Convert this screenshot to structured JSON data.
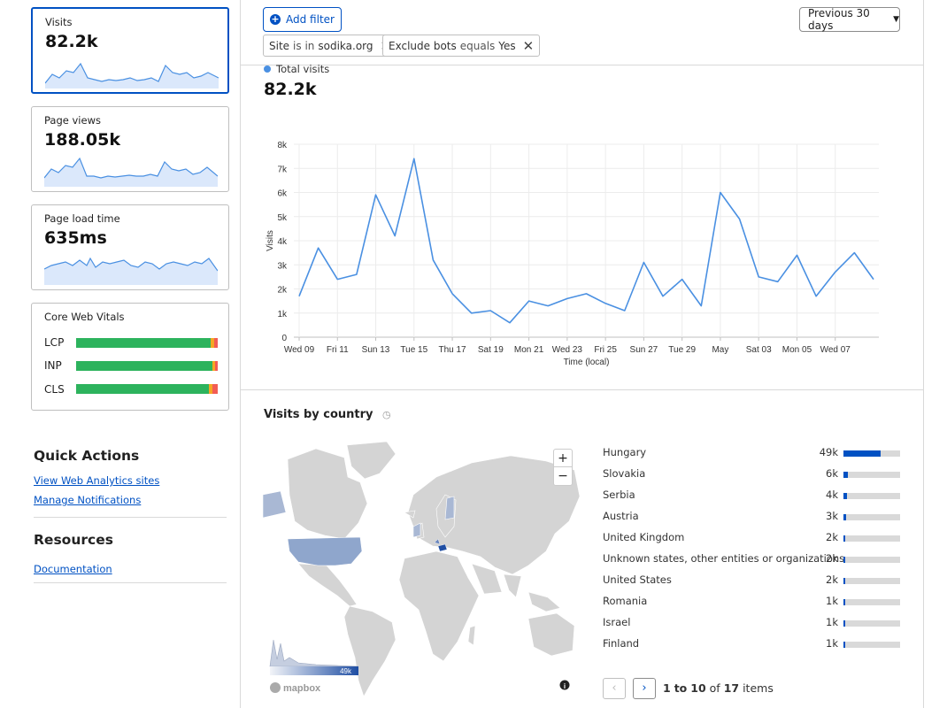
{
  "cards": {
    "visits": {
      "title": "Visits",
      "value": "82.2k"
    },
    "pageviews": {
      "title": "Page views",
      "value": "188.05k"
    },
    "loadtime": {
      "title": "Page load time",
      "value": "635ms"
    },
    "cwv": {
      "title": "Core Web Vitals",
      "metrics": [
        {
          "label": "LCP",
          "good": 0.95,
          "ni": 0.025,
          "poor": 0.025
        },
        {
          "label": "INP",
          "good": 0.96,
          "ni": 0.02,
          "poor": 0.02
        },
        {
          "label": "CLS",
          "good": 0.94,
          "ni": 0.02,
          "poor": 0.04
        }
      ]
    }
  },
  "quick_actions": {
    "title": "Quick Actions",
    "links": [
      "View Web Analytics sites",
      "Manage Notifications"
    ]
  },
  "resources": {
    "title": "Resources",
    "links": [
      "Documentation"
    ]
  },
  "filters": {
    "add_label": "Add filter",
    "chips": [
      {
        "field": "Site",
        "op": "is in",
        "value": "sodika.org"
      },
      {
        "field": "Exclude bots",
        "op": "equals",
        "value": "Yes"
      }
    ],
    "period": "Previous 30 days"
  },
  "summary": {
    "legend": "Total visits",
    "value": "82.2k"
  },
  "colors": {
    "accent": "#0051c3",
    "line": "#4a90e2",
    "good": "#2db35d",
    "ni": "#f5a623",
    "poor": "#f25c54"
  },
  "chart_data": {
    "type": "line",
    "ylabel": "Visits",
    "xlabel": "Time (local)",
    "ylim": [
      0,
      8000
    ],
    "yticks": [
      "0",
      "1k",
      "2k",
      "3k",
      "4k",
      "5k",
      "6k",
      "7k",
      "8k"
    ],
    "xtick_labels": [
      "Wed 09",
      "Fri 11",
      "Sun 13",
      "Tue 15",
      "Thu 17",
      "Sat 19",
      "Mon 21",
      "Wed 23",
      "Fri 25",
      "Sun 27",
      "Tue 29",
      "May",
      "Sat 03",
      "Mon 05",
      "Wed 07"
    ],
    "series": [
      {
        "values": [
          1700,
          3700,
          2400,
          2600,
          5900,
          4200,
          7400,
          3200,
          1800,
          1000,
          1100,
          600,
          1500,
          1300,
          1600,
          1800,
          1400,
          1100,
          3100,
          1700,
          2400,
          1300,
          6000,
          4900,
          2500,
          2300,
          3400,
          1700,
          2700,
          3500,
          2400
        ]
      }
    ]
  },
  "country_section": {
    "title": "Visits by country",
    "legend_max": "49k",
    "attribution": "mapbox",
    "countries": [
      {
        "name": "Hungary",
        "value": "49k",
        "share": 0.66
      },
      {
        "name": "Slovakia",
        "value": "6k",
        "share": 0.08
      },
      {
        "name": "Serbia",
        "value": "4k",
        "share": 0.06
      },
      {
        "name": "Austria",
        "value": "3k",
        "share": 0.04
      },
      {
        "name": "United Kingdom",
        "value": "2k",
        "share": 0.03
      },
      {
        "name": "Unknown states, other entities or organizations",
        "value": "2k",
        "share": 0.03
      },
      {
        "name": "United States",
        "value": "2k",
        "share": 0.03
      },
      {
        "name": "Romania",
        "value": "1k",
        "share": 0.02
      },
      {
        "name": "Israel",
        "value": "1k",
        "share": 0.02
      },
      {
        "name": "Finland",
        "value": "1k",
        "share": 0.02
      }
    ],
    "pager": {
      "from": "1",
      "to": "10",
      "total": "17",
      "of": "of",
      "to_word": "to",
      "items_word": "items"
    }
  }
}
